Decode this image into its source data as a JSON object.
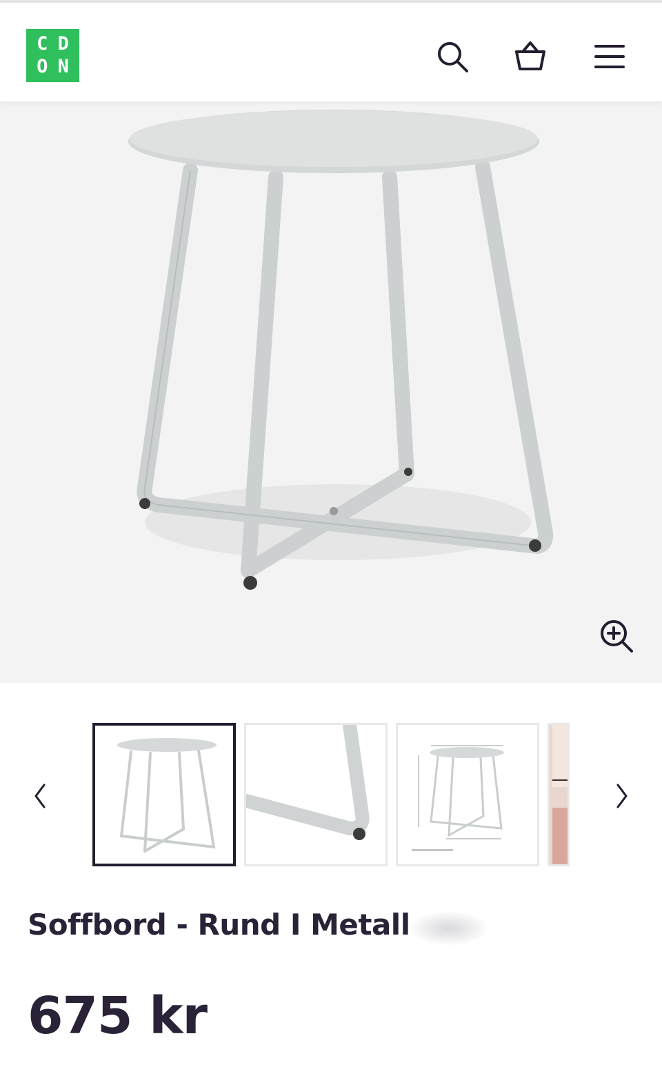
{
  "header": {
    "logo_letters": [
      "C",
      "D",
      "O",
      "N"
    ],
    "logo_color": "#2fbf5c",
    "icons": [
      "search-icon",
      "basket-icon",
      "menu-icon"
    ]
  },
  "hero": {
    "image": "round metal side table, light grey",
    "zoom_icon": "zoom-in-icon"
  },
  "gallery": {
    "prev_icon": "chevron-left-icon",
    "next_icon": "chevron-right-icon",
    "active_index": 0,
    "thumbnail_count_visible": 4
  },
  "product": {
    "title": "Soffbord - Rund I Metall",
    "price": "675 kr"
  },
  "colors": {
    "text": "#2a2337",
    "hero_bg": "#f3f3f3",
    "active_thumb_border": "#241d2f"
  }
}
